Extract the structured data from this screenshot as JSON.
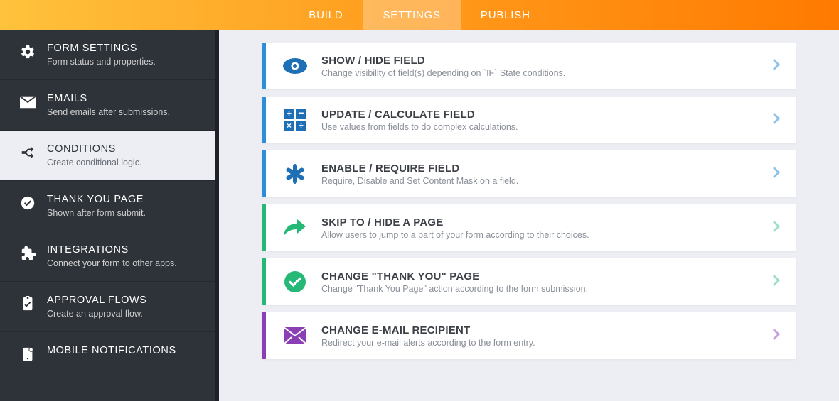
{
  "topbar": {
    "tabs": [
      {
        "label": "BUILD"
      },
      {
        "label": "SETTINGS"
      },
      {
        "label": "PUBLISH"
      }
    ],
    "activeIndex": 1
  },
  "sidebar": {
    "items": [
      {
        "title": "FORM SETTINGS",
        "sub": "Form status and properties.",
        "icon": "gear"
      },
      {
        "title": "EMAILS",
        "sub": "Send emails after submissions.",
        "icon": "mail"
      },
      {
        "title": "CONDITIONS",
        "sub": "Create conditional logic.",
        "icon": "shuffle"
      },
      {
        "title": "THANK YOU PAGE",
        "sub": "Shown after form submit.",
        "icon": "check-circle"
      },
      {
        "title": "INTEGRATIONS",
        "sub": "Connect your form to other apps.",
        "icon": "puzzle"
      },
      {
        "title": "APPROVAL FLOWS",
        "sub": "Create an approval flow.",
        "icon": "clipboard"
      },
      {
        "title": "MOBILE NOTIFICATIONS",
        "sub": "",
        "icon": "bell"
      }
    ],
    "activeIndex": 2
  },
  "cards": [
    {
      "title": "SHOW / HIDE FIELD",
      "sub": "Change visibility of field(s) depending on `IF` State conditions.",
      "accent": "blue",
      "icon": "eye",
      "color": "#1f6fb7"
    },
    {
      "title": "UPDATE / CALCULATE FIELD",
      "sub": "Use values from fields to do complex calculations.",
      "accent": "blue",
      "icon": "calc",
      "color": "#1f6fb7"
    },
    {
      "title": "ENABLE / REQUIRE FIELD",
      "sub": "Require, Disable and Set Content Mask on a field.",
      "accent": "blue",
      "icon": "asterisk",
      "color": "#1f6fb7"
    },
    {
      "title": "SKIP TO / HIDE A PAGE",
      "sub": "Allow users to jump to a part of your form according to their choices.",
      "accent": "green",
      "icon": "arrow-share",
      "color": "#25b877"
    },
    {
      "title": "CHANGE \"THANK YOU\" PAGE",
      "sub": "Change \"Thank You Page\" action according to the form submission.",
      "accent": "green",
      "icon": "check-badge",
      "color": "#25b877"
    },
    {
      "title": "CHANGE E-MAIL RECIPIENT",
      "sub": "Redirect your e-mail alerts according to the form entry.",
      "accent": "purple",
      "icon": "mail-solid",
      "color": "#8b3fb5"
    }
  ]
}
